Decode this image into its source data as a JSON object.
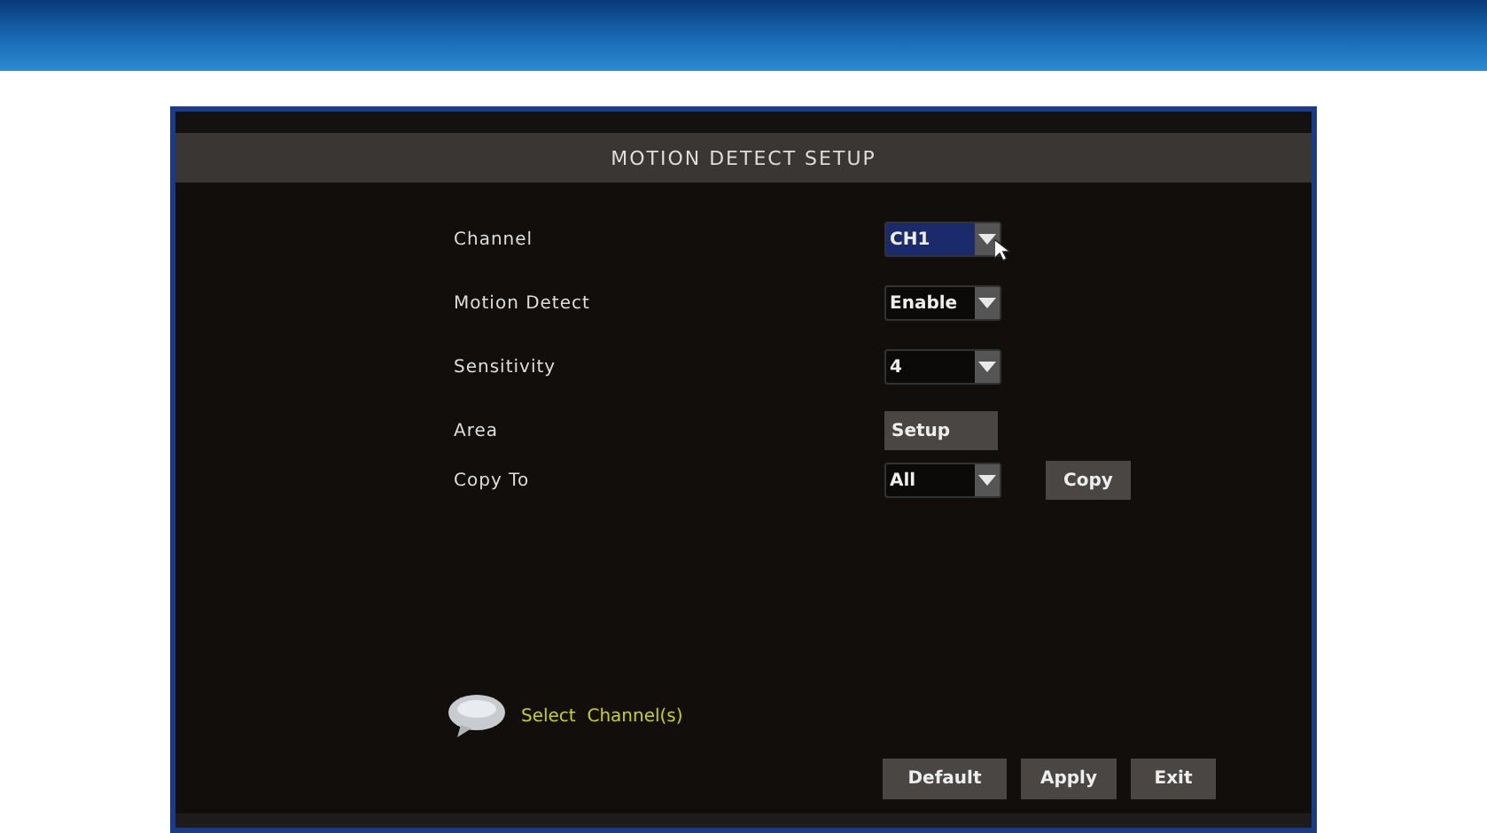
{
  "dialog": {
    "title": "MOTION DETECT SETUP",
    "rows": [
      {
        "label": "Channel",
        "kind": "select",
        "value": "CH1",
        "focused": true
      },
      {
        "label": "Motion Detect",
        "kind": "select",
        "value": "Enable",
        "focused": false
      },
      {
        "label": "Sensitivity",
        "kind": "select",
        "value": "4",
        "focused": false
      },
      {
        "label": "Area",
        "kind": "button",
        "value": "Setup"
      },
      {
        "label": "Copy To",
        "kind": "select",
        "value": "All",
        "focused": false,
        "action": "Copy"
      }
    ],
    "hint": "Select  Channel(s)",
    "buttons": [
      "Default",
      "Apply",
      "Exit"
    ]
  }
}
